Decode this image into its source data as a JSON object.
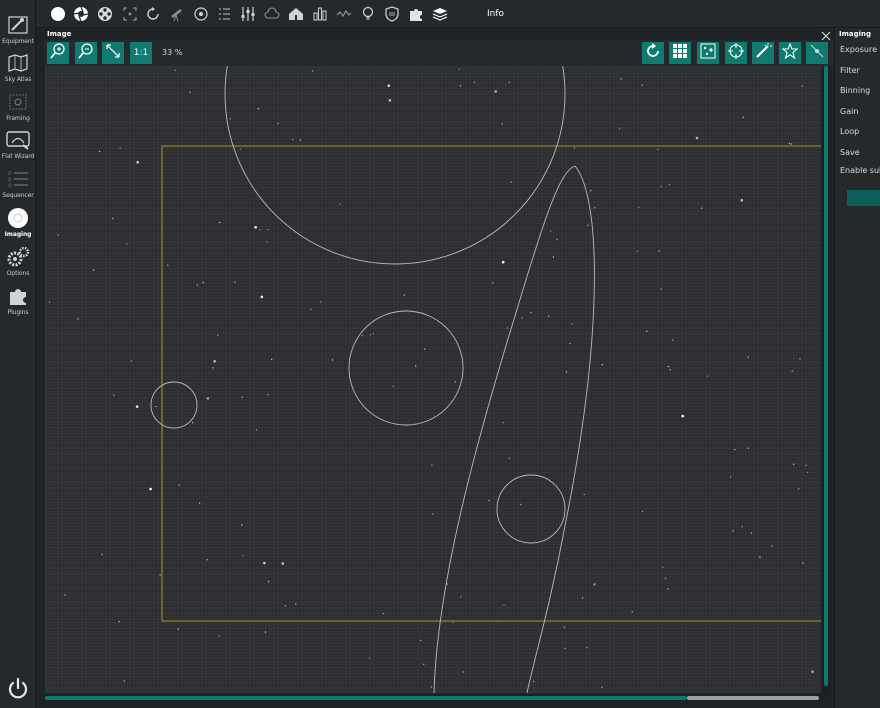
{
  "sidebar": {
    "items": [
      {
        "label": "Equipment",
        "icon": "telescope-icon"
      },
      {
        "label": "Sky Atlas",
        "icon": "map-icon"
      },
      {
        "label": "Framing",
        "icon": "framing-icon"
      },
      {
        "label": "Flat Wizard",
        "icon": "flat-wizard-icon"
      },
      {
        "label": "Sequencer",
        "icon": "sequencer-icon"
      },
      {
        "label": "Imaging",
        "icon": "camera-icon",
        "active": true
      },
      {
        "label": "Options",
        "icon": "gears-icon"
      },
      {
        "label": "Plugins",
        "icon": "puzzle-icon"
      }
    ],
    "power_icon": "power-icon"
  },
  "topbar": {
    "icons": [
      "camera-icon",
      "aperture-icon",
      "filter-wheel-icon",
      "focuser-icon",
      "rotator-icon",
      "telescope-icon",
      "guider-icon",
      "switch-icon",
      "sliders-icon",
      "dome-icon",
      "histogram-icon",
      "guide-graph-icon",
      "lightbulb-icon",
      "safety-shield-icon",
      "puzzle-icon",
      "layers-icon"
    ],
    "info_label": "Info"
  },
  "image_panel": {
    "title": "Image",
    "zoom_buttons": {
      "zoom_in": "zoom-in-icon",
      "zoom_out": "zoom-out-icon",
      "fit": "fit-icon",
      "one_to_one": "1:1"
    },
    "zoom_percent": "33 %",
    "right_tools": [
      "auto-stretch-icon",
      "grid-icon",
      "star-detection-icon",
      "crosshair-icon",
      "magic-wand-icon",
      "star-icon",
      "annotate-icon"
    ]
  },
  "right_panel": {
    "title": "Imaging",
    "rows": [
      "Exposure ti",
      "Filter",
      "Binning",
      "Gain",
      "Loop",
      "Save",
      "Enable subs"
    ]
  },
  "colors": {
    "accent": "#0e7a70",
    "background": "#1f2326",
    "panel": "#24292c",
    "frame": "#a8912c"
  }
}
